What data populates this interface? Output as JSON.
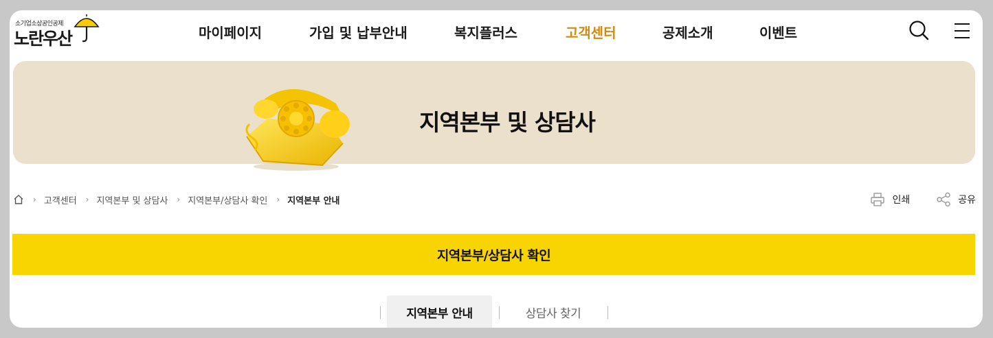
{
  "logo": {
    "subtitle": "소기업소상공인공제",
    "name": "노란우산"
  },
  "gnb": {
    "items": [
      {
        "label": "마이페이지",
        "active": false
      },
      {
        "label": "가입 및 납부안내",
        "active": false
      },
      {
        "label": "복지플러스",
        "active": false
      },
      {
        "label": "고객센터",
        "active": true
      },
      {
        "label": "공제소개",
        "active": false
      },
      {
        "label": "이벤트",
        "active": false
      }
    ],
    "active_color": "#d28a13"
  },
  "utility": {
    "search_icon": "search-icon",
    "menu_icon": "hamburger-menu-icon"
  },
  "visual": {
    "title": "지역본부 및 상담사",
    "background": "#ebe0cc",
    "image_icon": "rotary-phone-illustration"
  },
  "breadcrumb": {
    "home_icon": "home-icon",
    "items": [
      "고객센터",
      "지역본부 및 상담사",
      "지역본부/상담사 확인",
      "지역본부 안내"
    ]
  },
  "tools": {
    "print_label": "인쇄",
    "share_label": "공유"
  },
  "section": {
    "title": "지역본부/상담사 확인",
    "background": "#f8d500"
  },
  "tabs": [
    {
      "label": "지역본부 안내",
      "active": true
    },
    {
      "label": "상담사 찾기",
      "active": false
    }
  ]
}
